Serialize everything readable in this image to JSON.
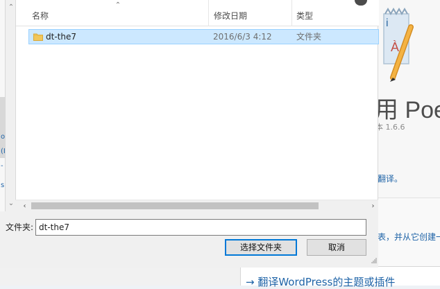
{
  "background": {
    "title_text": "用 Poed",
    "version_text": "本 1.6.6",
    "line1": "翻译。",
    "line2": "表，并从它创建一",
    "link_text": "→ 翻译WordPress的主题或插件",
    "left_rail_glyphs": [
      "o",
      "(I",
      "-",
      "s)"
    ]
  },
  "dialog": {
    "columns": {
      "name": "名称",
      "date": "修改日期",
      "type": "类型"
    },
    "rows": [
      {
        "name": "dt-the7",
        "date": "2016/6/3 4:12",
        "type": "文件夹"
      }
    ],
    "folder_label": "文件夹:",
    "folder_value": "dt-the7",
    "buttons": {
      "select": "选择文件夹",
      "cancel": "取消"
    }
  },
  "icons": {
    "folder": "folder-icon",
    "sort_up": "sort-up-icon",
    "scroll_left": "chevron-left-icon",
    "scroll_right": "chevron-right-icon",
    "scroll_up": "chevron-up-icon",
    "scroll_down": "chevron-down-icon",
    "resize": "resize-grip-icon",
    "app": "poedit-app-icon"
  },
  "colors": {
    "selection": "#cce8ff",
    "selection_border": "#99d1ff",
    "accent": "#0078d7",
    "link": "#1e63a7"
  }
}
